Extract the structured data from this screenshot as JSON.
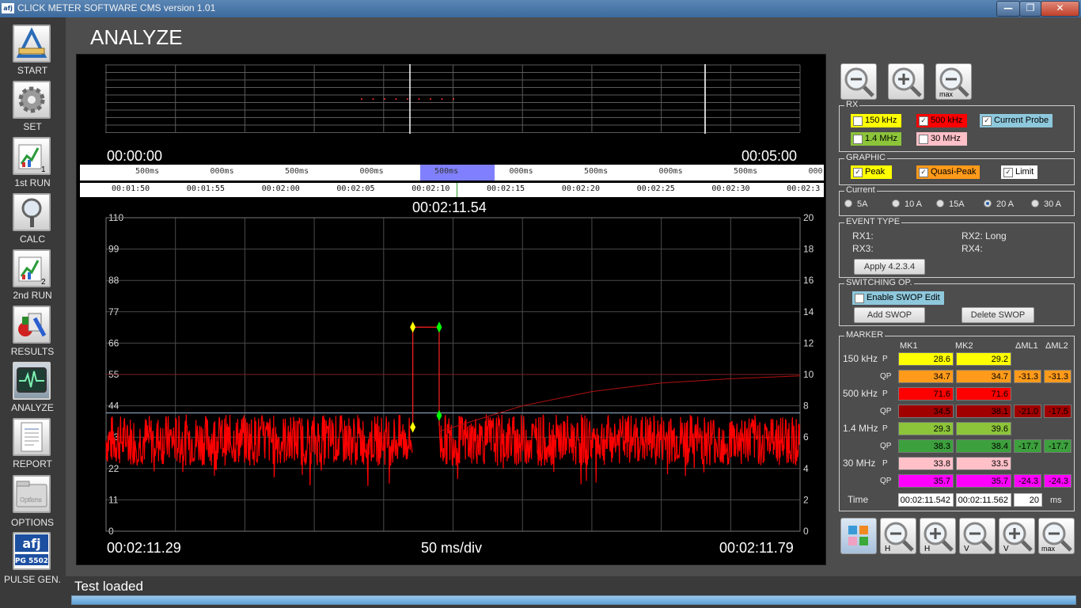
{
  "window": {
    "title": "CLICK METER SOFTWARE CMS version 1.01",
    "logo": "afj",
    "minimize_label": "—",
    "maximize_label": "❐",
    "close_label": "✕"
  },
  "sidebar": {
    "items": [
      {
        "label": "START",
        "icon": "ruler-triangle-icon"
      },
      {
        "label": "SET",
        "icon": "gear-icon"
      },
      {
        "label": "1st RUN",
        "icon": "run-chart-icon",
        "badge": "1"
      },
      {
        "label": "CALC",
        "icon": "magnifier-icon"
      },
      {
        "label": "2nd RUN",
        "icon": "run-chart-icon",
        "badge": "2"
      },
      {
        "label": "RESULTS",
        "icon": "results-icon"
      },
      {
        "label": "ANALYZE",
        "icon": "heartbeat-monitor-icon",
        "active": true
      },
      {
        "label": "REPORT",
        "icon": "document-icon"
      },
      {
        "label": "OPTIONS",
        "icon": "options-folder-icon",
        "icon_text": "Options"
      },
      {
        "label": "PULSE GEN.",
        "icon": "afj-logo-icon",
        "icon_text_top": "afj",
        "icon_text_bottom": "PG 5502"
      }
    ]
  },
  "page_title": "ANALYZE",
  "overview": {
    "start_time": "00:00:00",
    "end_time": "00:05:00"
  },
  "ruler": {
    "segments": [
      "500ms",
      "000ms",
      "500ms",
      "000ms",
      "500ms",
      "000ms",
      "500ms",
      "000ms",
      "500ms",
      "000"
    ],
    "highlight_index": 4,
    "times": [
      "00:01:50",
      "00:01:55",
      "00:02:00",
      "00:02:05",
      "00:02:10",
      "00:02:15",
      "00:02:20",
      "00:02:25",
      "00:02:30",
      "00:02:3"
    ]
  },
  "cursor_time": "00:02:11.54",
  "chart_footer": {
    "left_time": "00:02:11.29",
    "scale": "50 ms/div",
    "right_time": "00:02:11.79"
  },
  "chart_data": {
    "type": "line",
    "y_left": {
      "ticks": [
        0,
        11,
        22,
        33,
        44,
        55,
        66,
        77,
        88,
        99,
        110
      ],
      "range": [
        0,
        110
      ]
    },
    "y_right": {
      "ticks": [
        0,
        2,
        4,
        6,
        8,
        10,
        12,
        14,
        16,
        18,
        20
      ],
      "range": [
        0,
        20
      ]
    },
    "x_range_ms": [
      0,
      500
    ],
    "grid": true,
    "series": [
      {
        "color": "#ff0000",
        "noise_mean": 32,
        "noise_amp": 9,
        "gap_ms": [
          221,
          240
        ]
      },
      {
        "color": "#9fb8d8",
        "level": 41.5
      },
      {
        "color": "#7a2020",
        "level": 55
      },
      {
        "color": "#b01010",
        "curve": [
          [
            240,
            35
          ],
          [
            300,
            44
          ],
          [
            350,
            49
          ],
          [
            400,
            52
          ],
          [
            450,
            53.5
          ],
          [
            500,
            54.5
          ]
        ]
      }
    ],
    "marker_pulse": {
      "x_start_ms": 221,
      "x_end_ms": 240,
      "level": 71.6
    },
    "markers": [
      {
        "x_ms": 221,
        "y": 71.6,
        "color": "#ffff00"
      },
      {
        "x_ms": 240,
        "y": 71.6,
        "color": "#00ff00"
      },
      {
        "x_ms": 221,
        "y": 36.5,
        "color": "#ffff00"
      },
      {
        "x_ms": 240,
        "y": 40.6,
        "color": "#00ff00"
      }
    ]
  },
  "zoom_top": [
    {
      "icon": "zoom-out-icon",
      "label": ""
    },
    {
      "icon": "zoom-in-icon",
      "label": ""
    },
    {
      "icon": "zoom-max-icon",
      "label": "max"
    }
  ],
  "rx": {
    "title": "RX",
    "items": [
      {
        "label": "150 kHz",
        "checked": false,
        "color": "#ffff00"
      },
      {
        "label": "500 kHz",
        "checked": true,
        "color": "#ff0000"
      },
      {
        "label": "Current Probe",
        "checked": true,
        "color": "#8ec8dc"
      },
      {
        "label": "1.4 MHz",
        "checked": false,
        "color": "#8cc43a"
      },
      {
        "label": "30 MHz",
        "checked": false,
        "color": "#ffc0c8"
      }
    ]
  },
  "graphic": {
    "title": "GRAPHIC",
    "items": [
      {
        "label": "Peak",
        "checked": true,
        "color": "#ffff00"
      },
      {
        "label": "Quasi-Peak",
        "checked": true,
        "color": "#ff9a1a"
      },
      {
        "label": "Limit",
        "checked": true,
        "color": "#ffffff"
      }
    ]
  },
  "current": {
    "title": "Current",
    "options": [
      "5A",
      "10 A",
      "15A",
      "20 A",
      "30 A"
    ],
    "selected": 3
  },
  "event_type": {
    "title": "EVENT TYPE",
    "rx1": "RX1:",
    "rx2": "RX2: Long",
    "rx3": "RX3:",
    "rx4": "RX4:",
    "apply_label": "Apply 4.2.3.4"
  },
  "switching": {
    "title": "SWITCHING OP.",
    "enable_label": "Enable SWOP Edit",
    "add_label": "Add SWOP",
    "delete_label": "Delete SWOP"
  },
  "marker": {
    "title": "MARKER",
    "headers": [
      "MK1",
      "MK2",
      "ΔML1",
      "ΔML2"
    ],
    "rows": [
      {
        "band": "150 kHz",
        "type": "P",
        "mk1": "28.6",
        "mk2": "29.2",
        "d1": "",
        "d2": "",
        "color": "#ffff00",
        "dcolor": ""
      },
      {
        "band": "",
        "type": "QP",
        "mk1": "34.7",
        "mk2": "34.7",
        "d1": "-31.3",
        "d2": "-31.3",
        "color": "#ff9a1a",
        "dcolor": "#ff9a1a"
      },
      {
        "band": "500 kHz",
        "type": "P",
        "mk1": "71.6",
        "mk2": "71.6",
        "d1": "",
        "d2": "",
        "color": "#ff0000",
        "dcolor": ""
      },
      {
        "band": "",
        "type": "QP",
        "mk1": "34.5",
        "mk2": "38.1",
        "d1": "-21.0",
        "d2": "-17.5",
        "color": "#a00000",
        "dcolor": "#a00000"
      },
      {
        "band": "1.4 MHz",
        "type": "P",
        "mk1": "29.3",
        "mk2": "39.6",
        "d1": "",
        "d2": "",
        "color": "#8cc43a",
        "dcolor": ""
      },
      {
        "band": "",
        "type": "QP",
        "mk1": "38.3",
        "mk2": "38.4",
        "d1": "-17.7",
        "d2": "-17.7",
        "color": "#3ca03c",
        "dcolor": "#3ca03c"
      },
      {
        "band": "30 MHz",
        "type": "P",
        "mk1": "33.8",
        "mk2": "33.5",
        "d1": "",
        "d2": "",
        "color": "#ffc0c8",
        "dcolor": ""
      },
      {
        "band": "",
        "type": "QP",
        "mk1": "35.7",
        "mk2": "35.7",
        "d1": "-24.3",
        "d2": "-24.3",
        "color": "#ff00ff",
        "dcolor": "#ff00ff"
      }
    ],
    "time_label": "Time",
    "time_mk1": "00:02:11.542",
    "time_mk2": "00:02:11.562",
    "delta_value": "20",
    "delta_unit": "ms"
  },
  "zoom_bottom": [
    {
      "icon": "grid-color-icon",
      "label": ""
    },
    {
      "icon": "zoom-out-h-icon",
      "label": "H"
    },
    {
      "icon": "zoom-in-h-icon",
      "label": "H"
    },
    {
      "icon": "zoom-out-v-icon",
      "label": "V"
    },
    {
      "icon": "zoom-in-v-icon",
      "label": "V"
    },
    {
      "icon": "zoom-max-icon",
      "label": "max"
    }
  ],
  "status": "Test loaded"
}
